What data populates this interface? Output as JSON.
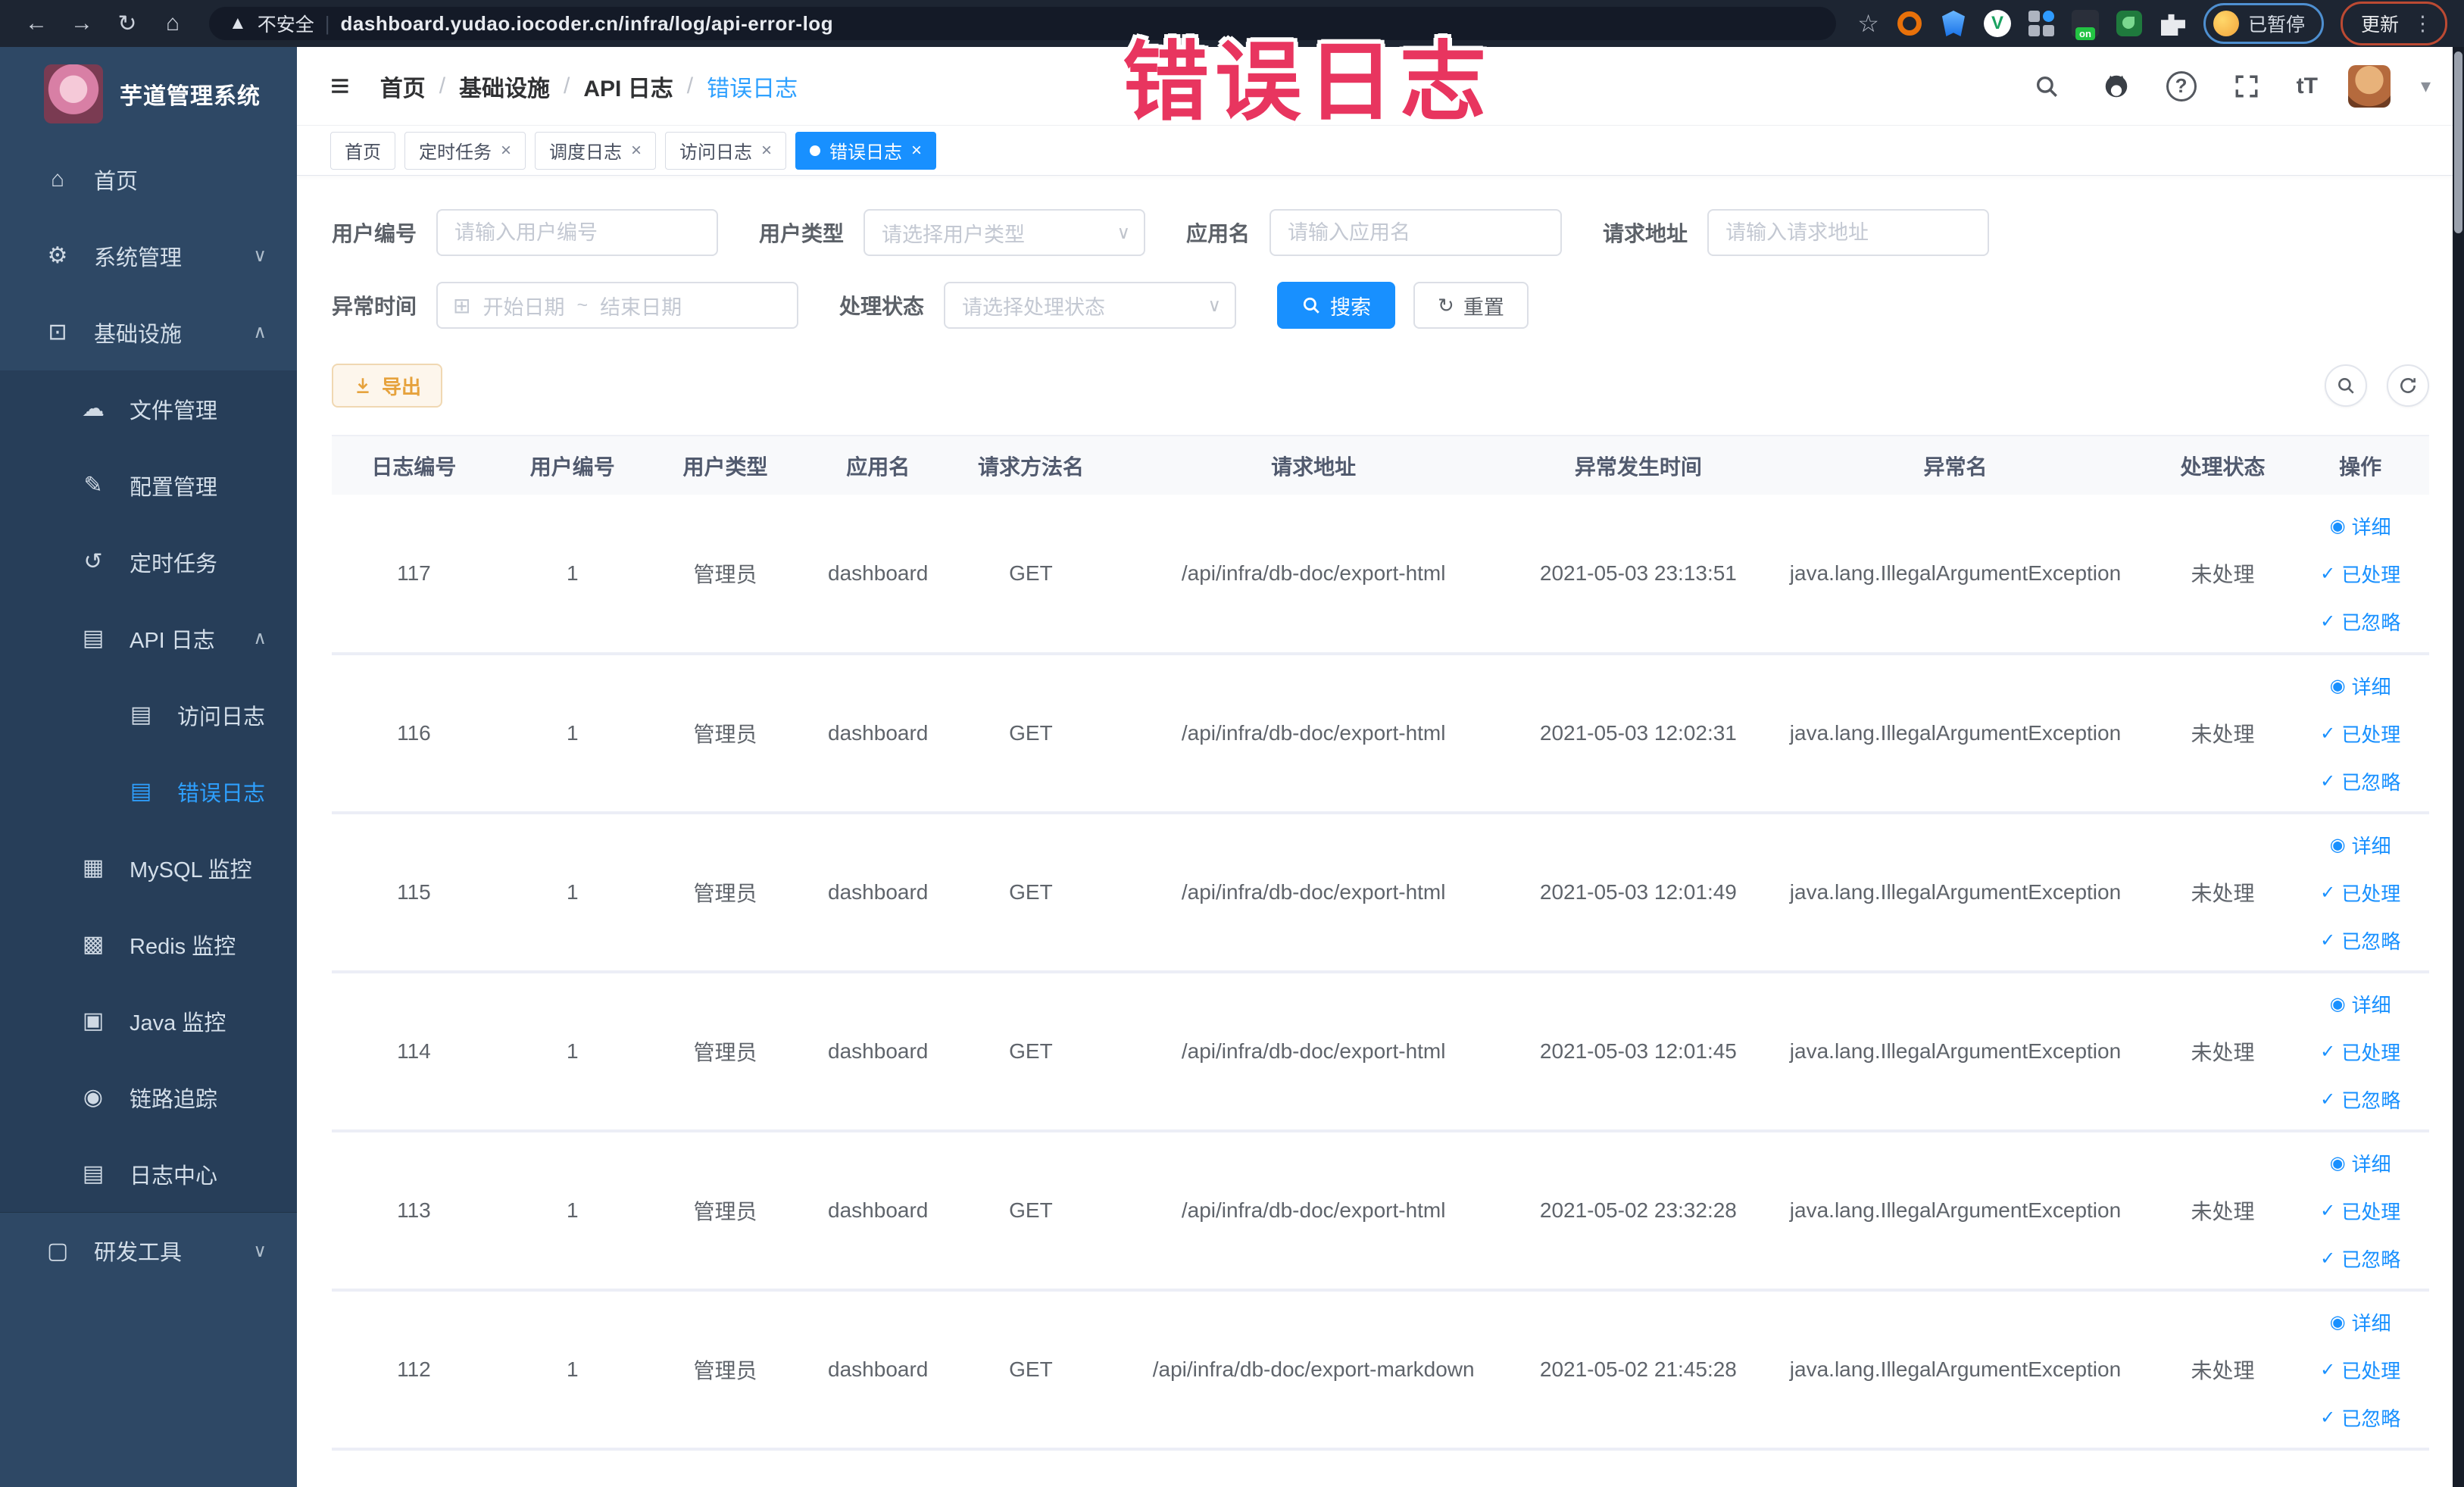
{
  "browser": {
    "security_label": "不安全",
    "url": "dashboard.yudao.iocoder.cn/infra/log/api-error-log",
    "paused_label": "已暂停",
    "update_label": "更新"
  },
  "overlay": {
    "text": "错误日志"
  },
  "icons": {
    "warning": "▲",
    "star": "☆",
    "kebab": "⋮",
    "hamburger": "≡",
    "caret_down": "▾",
    "chevron_down": "∨",
    "chevron_up": "∧",
    "calendar": "⊞",
    "reset": "↻",
    "eye": "◉",
    "check": "✓",
    "close": "×",
    "help": "?",
    "font_size": "tT",
    "back": "←",
    "forward": "→",
    "reload": "↻",
    "home": "⌂",
    "green_v": "V",
    "on_badge": "on"
  },
  "sidebar": {
    "title": "芋道管理系统",
    "items": [
      {
        "label": "首页",
        "icon": "⌂"
      },
      {
        "label": "系统管理",
        "icon": "⚙"
      },
      {
        "label": "基础设施",
        "icon": "⊡"
      },
      {
        "label": "文件管理",
        "icon": "☁"
      },
      {
        "label": "配置管理",
        "icon": "✎"
      },
      {
        "label": "定时任务",
        "icon": "↺"
      },
      {
        "label": "API 日志",
        "icon": "▤"
      },
      {
        "label": "访问日志",
        "icon": "▤"
      },
      {
        "label": "错误日志",
        "icon": "▤"
      },
      {
        "label": "MySQL 监控",
        "icon": "▦"
      },
      {
        "label": "Redis 监控",
        "icon": "▩"
      },
      {
        "label": "Java 监控",
        "icon": "▣"
      },
      {
        "label": "链路追踪",
        "icon": "◉"
      },
      {
        "label": "日志中心",
        "icon": "▤"
      },
      {
        "label": "研发工具",
        "icon": "▢"
      }
    ]
  },
  "breadcrumb": {
    "items": [
      "首页",
      "基础设施",
      "API 日志",
      "错误日志"
    ],
    "separator": "/"
  },
  "tabs": [
    {
      "label": "首页"
    },
    {
      "label": "定时任务"
    },
    {
      "label": "调度日志"
    },
    {
      "label": "访问日志"
    },
    {
      "label": "错误日志"
    }
  ],
  "filters": {
    "user_id": {
      "label": "用户编号",
      "placeholder": "请输入用户编号"
    },
    "user_type": {
      "label": "用户类型",
      "placeholder": "请选择用户类型"
    },
    "app_name": {
      "label": "应用名",
      "placeholder": "请输入应用名"
    },
    "request_url": {
      "label": "请求地址",
      "placeholder": "请输入请求地址"
    },
    "exception_time": {
      "label": "异常时间",
      "start_placeholder": "开始日期",
      "separator": "~",
      "end_placeholder": "结束日期"
    },
    "process_status": {
      "label": "处理状态",
      "placeholder": "请选择处理状态"
    },
    "search_label": "搜索",
    "reset_label": "重置"
  },
  "toolbar": {
    "export_label": "导出"
  },
  "actions": {
    "detail": "详细",
    "processed": "已处理",
    "ignored": "已忽略"
  },
  "table": {
    "columns": [
      "日志编号",
      "用户编号",
      "用户类型",
      "应用名",
      "请求方法名",
      "请求地址",
      "异常发生时间",
      "异常名",
      "处理状态",
      "操作"
    ],
    "rows": [
      {
        "id": "117",
        "user_id": "1",
        "user_type": "管理员",
        "app_name": "dashboard",
        "method": "GET",
        "url": "/api/infra/db-doc/export-html",
        "time": "2021-05-03 23:13:51",
        "exception": "java.lang.IllegalArgumentException",
        "status": "未处理"
      },
      {
        "id": "116",
        "user_id": "1",
        "user_type": "管理员",
        "app_name": "dashboard",
        "method": "GET",
        "url": "/api/infra/db-doc/export-html",
        "time": "2021-05-03 12:02:31",
        "exception": "java.lang.IllegalArgumentException",
        "status": "未处理"
      },
      {
        "id": "115",
        "user_id": "1",
        "user_type": "管理员",
        "app_name": "dashboard",
        "method": "GET",
        "url": "/api/infra/db-doc/export-html",
        "time": "2021-05-03 12:01:49",
        "exception": "java.lang.IllegalArgumentException",
        "status": "未处理"
      },
      {
        "id": "114",
        "user_id": "1",
        "user_type": "管理员",
        "app_name": "dashboard",
        "method": "GET",
        "url": "/api/infra/db-doc/export-html",
        "time": "2021-05-03 12:01:45",
        "exception": "java.lang.IllegalArgumentException",
        "status": "未处理"
      },
      {
        "id": "113",
        "user_id": "1",
        "user_type": "管理员",
        "app_name": "dashboard",
        "method": "GET",
        "url": "/api/infra/db-doc/export-html",
        "time": "2021-05-02 23:32:28",
        "exception": "java.lang.IllegalArgumentException",
        "status": "未处理"
      },
      {
        "id": "112",
        "user_id": "1",
        "user_type": "管理员",
        "app_name": "dashboard",
        "method": "GET",
        "url": "/api/infra/db-doc/export-markdown",
        "time": "2021-05-02 21:45:28",
        "exception": "java.lang.IllegalArgumentException",
        "status": "未处理"
      }
    ]
  }
}
